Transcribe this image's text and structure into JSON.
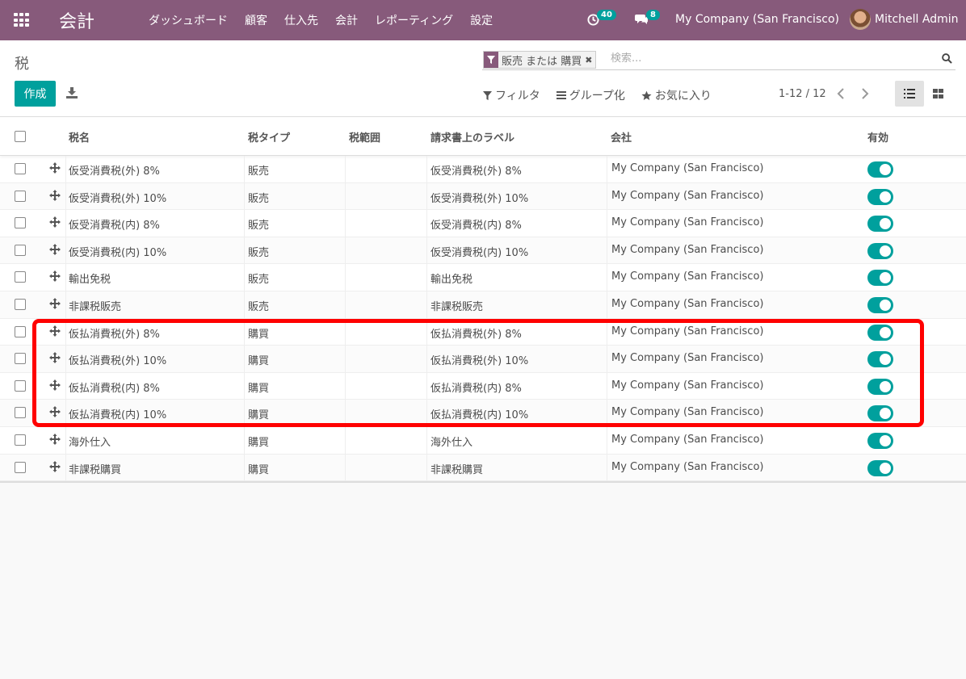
{
  "navbar": {
    "app_title": "会計",
    "menu": [
      "ダッシュボード",
      "顧客",
      "仕入先",
      "会計",
      "レポーティング",
      "設定"
    ],
    "activity_count": "40",
    "message_count": "8",
    "company": "My Company (San Francisco)",
    "user": "Mitchell Admin"
  },
  "control_panel": {
    "breadcrumb": "税",
    "search": {
      "facet": "販売 または 購買",
      "placeholder": "検索..."
    },
    "create_label": "作成",
    "filters_label": "フィルタ",
    "group_by_label": "グループ化",
    "favorites_label": "お気に入り",
    "pager": "1-12 / 12"
  },
  "table": {
    "headers": {
      "name": "税名",
      "type": "税タイプ",
      "scope": "税範囲",
      "label": "請求書上のラベル",
      "company": "会社",
      "active": "有効"
    },
    "rows": [
      {
        "name": "仮受消費税(外) 8%",
        "type": "販売",
        "label": "仮受消費税(外) 8%",
        "company": "My Company (San Francisco)",
        "active": true
      },
      {
        "name": "仮受消費税(外) 10%",
        "type": "販売",
        "label": "仮受消費税(外) 10%",
        "company": "My Company (San Francisco)",
        "active": true
      },
      {
        "name": "仮受消費税(内) 8%",
        "type": "販売",
        "label": "仮受消費税(内) 8%",
        "company": "My Company (San Francisco)",
        "active": true
      },
      {
        "name": "仮受消費税(内) 10%",
        "type": "販売",
        "label": "仮受消費税(内) 10%",
        "company": "My Company (San Francisco)",
        "active": true
      },
      {
        "name": "輸出免税",
        "type": "販売",
        "label": "輸出免税",
        "company": "My Company (San Francisco)",
        "active": true
      },
      {
        "name": "非課税販売",
        "type": "販売",
        "label": "非課税販売",
        "company": "My Company (San Francisco)",
        "active": true
      },
      {
        "name": "仮払消費税(外) 8%",
        "type": "購買",
        "label": "仮払消費税(外) 8%",
        "company": "My Company (San Francisco)",
        "active": true
      },
      {
        "name": "仮払消費税(外) 10%",
        "type": "購買",
        "label": "仮払消費税(外) 10%",
        "company": "My Company (San Francisco)",
        "active": true
      },
      {
        "name": "仮払消費税(内) 8%",
        "type": "購買",
        "label": "仮払消費税(内) 8%",
        "company": "My Company (San Francisco)",
        "active": true
      },
      {
        "name": "仮払消費税(内) 10%",
        "type": "購買",
        "label": "仮払消費税(内) 10%",
        "company": "My Company (San Francisco)",
        "active": true
      },
      {
        "name": "海外仕入",
        "type": "購買",
        "label": "海外仕入",
        "company": "My Company (San Francisco)",
        "active": true
      },
      {
        "name": "非課税購買",
        "type": "購買",
        "label": "非課税購買",
        "company": "My Company (San Francisco)",
        "active": true
      }
    ]
  },
  "colors": {
    "navbar": "#875a7b",
    "primary": "#00a09d",
    "highlight": "#ff0000"
  }
}
